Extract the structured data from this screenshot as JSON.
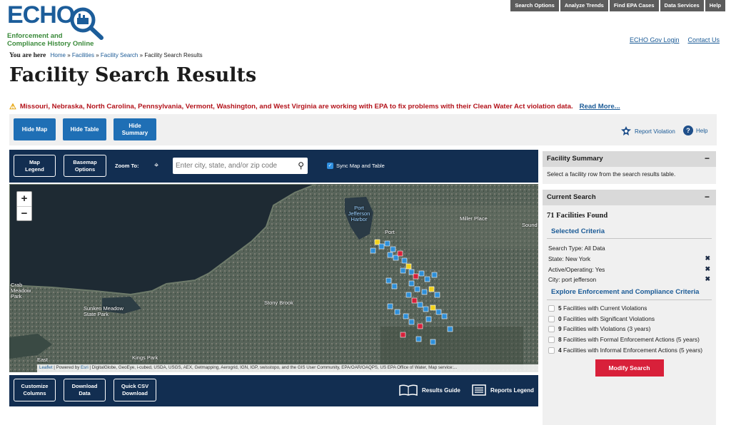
{
  "logo": {
    "word": "ECHO",
    "subtitle_line1": "Enforcement and",
    "subtitle_line2": "Compliance History Online"
  },
  "topnav": [
    "Search Options",
    "Analyze Trends",
    "Find EPA Cases",
    "Data Services",
    "Help"
  ],
  "gov_links": {
    "login": "ECHO Gov Login",
    "contact": "Contact Us"
  },
  "breadcrumb": {
    "you_are_here": "You are here",
    "items": [
      "Home",
      "Facilities",
      "Facility Search"
    ],
    "separator": "»",
    "current": "Facility Search Results"
  },
  "page_title": "Facility Search Results",
  "alert": {
    "message": "Missouri, Nebraska, North Carolina, Pennsylvania, Vermont, Washington, and West Virginia are working with EPA to fix problems with their Clean Water Act violation data.",
    "link": "Read More..."
  },
  "toolbar": {
    "hide_map": "Hide Map",
    "hide_table": "Hide Table",
    "hide_summary_1": "Hide",
    "hide_summary_2": "Summary",
    "report_violation": "Report Violation",
    "help": "Help"
  },
  "mapbar": {
    "legend_1": "Map",
    "legend_2": "Legend",
    "basemap_1": "Basemap",
    "basemap_2": "Options",
    "zoom_to": "Zoom To:",
    "search_placeholder": "Enter city, state, and/or zip code",
    "sync": "Sync Map and Table"
  },
  "map": {
    "places": {
      "port_jefferson_harbor": "Port Jefferson Harbor",
      "port": "Port",
      "miller_place": "Miller Place",
      "sound": "Sound",
      "crab_meadow_park": "Crab Meadow Park",
      "sunken_meadow": "Sunken Meadow State Park",
      "stony_brook": "Stony Brook",
      "kings_park": "Kings Park",
      "east": "East"
    },
    "attribution": {
      "leaflet": "Leaflet",
      "powered_by": "Powered by",
      "esri": "Esri",
      "sources": "DigitalGlobe, GeoEye, i-cubed, USDA, USGS, AEX, Getmapping, Aerogrid, IGN, IGP, swisstopo, and the GIS User Community, EPA/OAR/OAQPS, US EPA Office of Water, Map service:..."
    },
    "marker_colors": {
      "blue": "#2e8fd8",
      "yellow": "#f2d21b",
      "red": "#d8203a"
    }
  },
  "bottombar": {
    "customize_1": "Customize",
    "customize_2": "Columns",
    "download_1": "Download",
    "download_2": "Data",
    "quick_csv_1": "Quick CSV",
    "quick_csv_2": "Download",
    "results_guide": "Results Guide",
    "reports_legend": "Reports Legend"
  },
  "facility_summary": {
    "title": "Facility Summary",
    "collapse": "−",
    "text": "Select a facility row from the search results table."
  },
  "current_search": {
    "title": "Current Search",
    "collapse": "−",
    "found": "71 Facilities Found",
    "selected_criteria": "Selected Criteria",
    "criteria": [
      {
        "label": "Search Type: All Data",
        "removable": false
      },
      {
        "label": "State: New York",
        "removable": true
      },
      {
        "label": "Active/Operating: Yes",
        "removable": true
      },
      {
        "label": "City: port jefferson",
        "removable": true
      }
    ],
    "remove_glyph": "✖",
    "explore_title": "Explore Enforcement and Compliance Criteria",
    "facilities": [
      {
        "count": "5",
        "text": "Facilities with Current Violations"
      },
      {
        "count": "0",
        "text": "Facilities with Significant Violations"
      },
      {
        "count": "9",
        "text": "Facilities with Violations (3 years)"
      },
      {
        "count": "8",
        "text": "Facilities with Formal Enforcement Actions (5 years)"
      },
      {
        "count": "4",
        "text": "Facilities with Informal Enforcement Actions (5 years)"
      }
    ],
    "modify_button": "Modify Search"
  }
}
